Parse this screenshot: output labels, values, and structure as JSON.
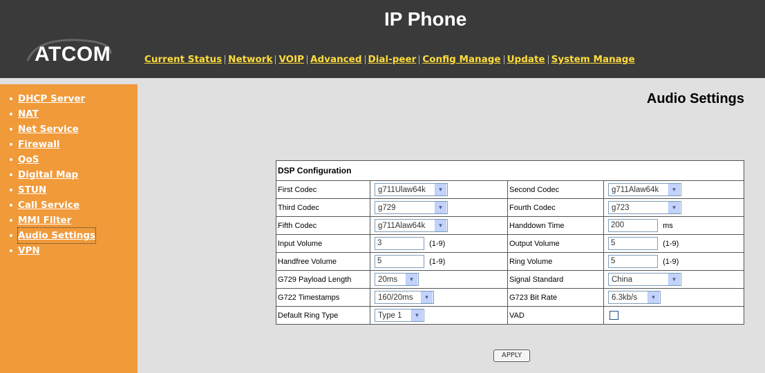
{
  "header": {
    "title": "IP Phone",
    "logo": "ATCOM",
    "nav": [
      {
        "label": "Current Status"
      },
      {
        "label": "Network"
      },
      {
        "label": "VOIP"
      },
      {
        "label": "Advanced"
      },
      {
        "label": "Dial-peer"
      },
      {
        "label": "Config Manage"
      },
      {
        "label": "Update"
      },
      {
        "label": "System Manage"
      }
    ],
    "colors": {
      "background": "#3a3a3a",
      "nav_link": "#ffdc3c"
    }
  },
  "sidebar": {
    "items": [
      {
        "label": "DHCP Server"
      },
      {
        "label": "NAT"
      },
      {
        "label": "Net Service"
      },
      {
        "label": "Firewall"
      },
      {
        "label": "QoS"
      },
      {
        "label": "Digital Map"
      },
      {
        "label": "STUN"
      },
      {
        "label": "Call Service"
      },
      {
        "label": "MMI Filter"
      },
      {
        "label": "Audio Settings",
        "active": true
      },
      {
        "label": "VPN"
      }
    ],
    "colors": {
      "background": "#f09a3a"
    }
  },
  "main": {
    "page_title": "Audio Settings",
    "table_title": "DSP Configuration",
    "rows": [
      {
        "l1": "First Codec",
        "v1": "g711Ulaw64k",
        "l2": "Second Codec",
        "v2": "g711Alaw64k"
      },
      {
        "l1": "Third Codec",
        "v1": "g729",
        "l2": "Fourth Codec",
        "v2": "g723"
      },
      {
        "l1": "Fifth Codec",
        "v1": "g711Alaw64k",
        "l2": "Handdown Time",
        "v2": "200",
        "u2": "ms"
      },
      {
        "l1": "Input Volume",
        "v1": "3",
        "u1": "(1-9)",
        "l2": "Output Volume",
        "v2": "5",
        "u2": "(1-9)"
      },
      {
        "l1": "Handfree Volume",
        "v1": "5",
        "u1": "(1-9)",
        "l2": "Ring Volume",
        "v2": "5",
        "u2": "(1-9)"
      },
      {
        "l1": "G729 Payload Length",
        "v1": "20ms",
        "l2": "Signal Standard",
        "v2": "China"
      },
      {
        "l1": "G722 Timestamps",
        "v1": "160/20ms",
        "l2": "G723 Bit Rate",
        "v2": "6.3kb/s"
      },
      {
        "l1": "Default Ring Type",
        "v1": "Type 1",
        "l2": "VAD",
        "v2_checked": false
      }
    ],
    "apply_label": "APPLY"
  }
}
